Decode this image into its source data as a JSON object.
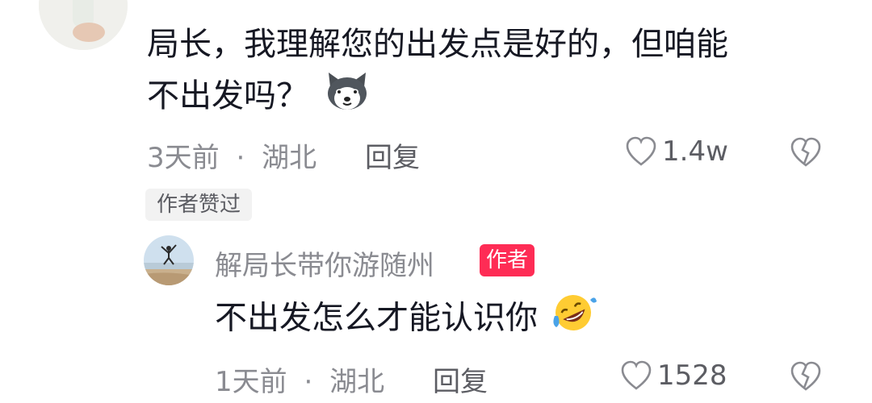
{
  "comment": {
    "text_line1": "局长，我理解您的出发点是好的，但咱能",
    "text_line2": "不出发吗？",
    "emoji": "dog-emoji",
    "time": "3天前",
    "separator": "·",
    "location": "湖北",
    "reply_label": "回复",
    "likes": "1.4w",
    "author_liked_badge": "作者赞过"
  },
  "reply": {
    "username": "解局长带你游随州",
    "author_tag": "作者",
    "text": "不出发怎么才能认识你",
    "emoji": "rofl-emoji",
    "time": "1天前",
    "separator": "·",
    "location": "湖北",
    "reply_label": "回复",
    "likes": "1528"
  },
  "colors": {
    "primary_text": "#161823",
    "secondary_text": "#8a8b91",
    "author_tag_bg": "#fe2c55"
  }
}
